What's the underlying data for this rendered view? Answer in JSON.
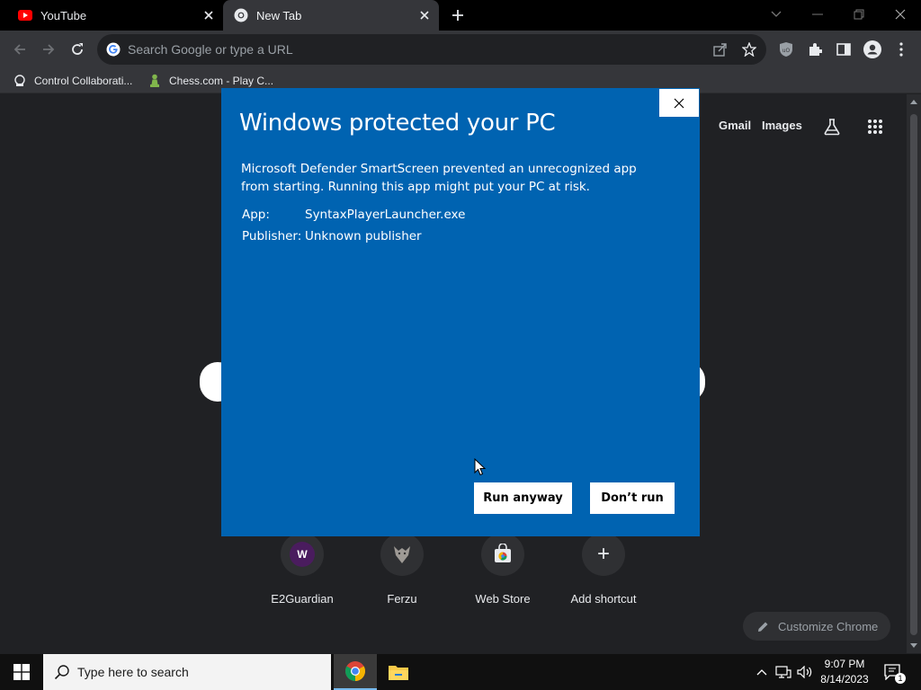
{
  "browser": {
    "tabs": [
      {
        "title": "YouTube",
        "active": false
      },
      {
        "title": "New Tab",
        "active": true
      }
    ],
    "omnibox": {
      "placeholder": "Search Google or type a URL"
    },
    "bookmarks": [
      {
        "label": "Control Collaborati..."
      },
      {
        "label": "Chess.com - Play C..."
      }
    ]
  },
  "ntp": {
    "links": {
      "gmail": "Gmail",
      "images": "Images"
    },
    "shortcuts": [
      {
        "label": "E2Guardian",
        "letter": "W"
      },
      {
        "label": "Ferzu"
      },
      {
        "label": "Web Store"
      },
      {
        "label": "Add shortcut",
        "glyph": "+"
      }
    ],
    "customize_label": "Customize Chrome"
  },
  "dialog": {
    "title": "Windows protected your PC",
    "message": "Microsoft Defender SmartScreen prevented an unrecognized app from starting. Running this app might put your PC at risk.",
    "app_key": "App:",
    "app_value": "SyntaxPlayerLauncher.exe",
    "publisher_key": "Publisher:",
    "publisher_value": "Unknown publisher",
    "run_anyway": "Run anyway",
    "dont_run": "Don’t run",
    "background_color": "#0063b1"
  },
  "taskbar": {
    "search_placeholder": "Type here to search",
    "time": "9:07 PM",
    "date": "8/14/2023",
    "notification_count": "1"
  },
  "icons": [
    "youtube-icon",
    "chrome-icon",
    "close-icon",
    "plus-icon",
    "back-icon",
    "forward-icon",
    "reload-icon",
    "google-icon",
    "share-icon",
    "star-icon",
    "ublock-icon",
    "extensions-icon",
    "side-panel-icon",
    "profile-icon",
    "menu-icon",
    "labs-icon",
    "apps-grid-icon",
    "pencil-icon",
    "windows-start-icon",
    "search-icon",
    "file-explorer-icon",
    "chevron-up-icon",
    "network-icon",
    "volume-icon",
    "notification-icon"
  ]
}
